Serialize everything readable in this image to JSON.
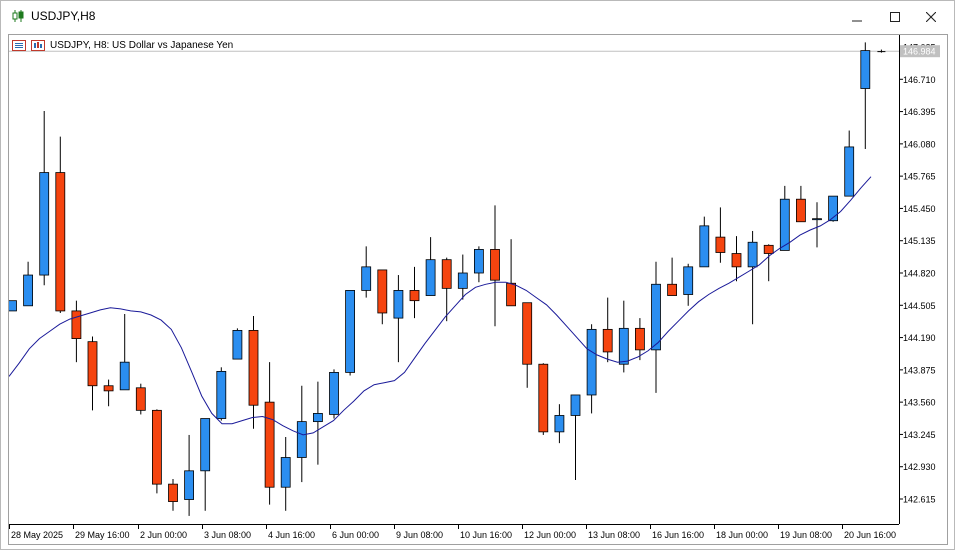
{
  "window": {
    "title": "USDJPY,H8",
    "icons": {
      "app": "candlestick-chart-icon",
      "minimize": "minimize-icon",
      "maximize": "maximize-icon",
      "close": "close-icon"
    }
  },
  "chart_header": {
    "text": "USDJPY, H8:  US Dollar vs Japanese Yen",
    "icons": [
      "ohlc-box-icon",
      "chart-settings-icon"
    ]
  },
  "colors": {
    "bull": "#2b8ef0",
    "bear": "#f5440f",
    "ma": "#1a1a99",
    "axis": "#000000",
    "price_label_bg": "#c0c0c0",
    "price_label_text": "#ffffff"
  },
  "chart_data": {
    "type": "candlestick",
    "symbol": "USDJPY",
    "timeframe": "H8",
    "current_price": "146.984",
    "y_ticks": [
      "147.025",
      "146.710",
      "146.395",
      "146.080",
      "145.765",
      "145.450",
      "145.135",
      "144.820",
      "144.505",
      "144.190",
      "143.875",
      "143.560",
      "143.245",
      "142.930",
      "142.615"
    ],
    "x_labels": [
      "28 May 2025",
      "29 May 16:00",
      "2 Jun 00:00",
      "3 Jun 08:00",
      "4 Jun 16:00",
      "6 Jun 00:00",
      "9 Jun 08:00",
      "10 Jun 16:00",
      "12 Jun 00:00",
      "13 Jun 08:00",
      "16 Jun 16:00",
      "18 Jun 00:00",
      "19 Jun 08:00",
      "20 Jun 16:00"
    ],
    "candles": [
      {
        "o": 144.45,
        "h": 144.55,
        "l": 144.45,
        "c": 144.55
      },
      {
        "o": 144.5,
        "h": 144.93,
        "l": 144.5,
        "c": 144.8
      },
      {
        "o": 144.8,
        "h": 146.4,
        "l": 144.7,
        "c": 145.8
      },
      {
        "o": 145.8,
        "h": 146.15,
        "l": 144.43,
        "c": 144.45
      },
      {
        "o": 144.45,
        "h": 144.55,
        "l": 143.95,
        "c": 144.18
      },
      {
        "o": 144.15,
        "h": 144.2,
        "l": 143.48,
        "c": 143.72
      },
      {
        "o": 143.72,
        "h": 143.78,
        "l": 143.52,
        "c": 143.67
      },
      {
        "o": 143.68,
        "h": 144.42,
        "l": 143.68,
        "c": 143.95
      },
      {
        "o": 143.7,
        "h": 143.74,
        "l": 143.44,
        "c": 143.48
      },
      {
        "o": 143.48,
        "h": 143.49,
        "l": 142.67,
        "c": 142.76
      },
      {
        "o": 142.76,
        "h": 142.81,
        "l": 142.5,
        "c": 142.59
      },
      {
        "o": 142.61,
        "h": 143.24,
        "l": 142.45,
        "c": 142.89
      },
      {
        "o": 142.89,
        "h": 143.36,
        "l": 142.5,
        "c": 143.4
      },
      {
        "o": 143.4,
        "h": 143.9,
        "l": 143.38,
        "c": 143.86
      },
      {
        "o": 143.98,
        "h": 144.28,
        "l": 143.98,
        "c": 144.26
      },
      {
        "o": 144.26,
        "h": 144.4,
        "l": 143.3,
        "c": 143.53
      },
      {
        "o": 143.56,
        "h": 143.95,
        "l": 142.56,
        "c": 142.73
      },
      {
        "o": 142.73,
        "h": 143.22,
        "l": 142.5,
        "c": 143.02
      },
      {
        "o": 143.02,
        "h": 143.72,
        "l": 142.78,
        "c": 143.37
      },
      {
        "o": 143.37,
        "h": 143.76,
        "l": 142.95,
        "c": 143.45
      },
      {
        "o": 143.44,
        "h": 143.88,
        "l": 143.4,
        "c": 143.85
      },
      {
        "o": 143.85,
        "h": 144.65,
        "l": 143.82,
        "c": 144.65
      },
      {
        "o": 144.65,
        "h": 145.08,
        "l": 144.58,
        "c": 144.88
      },
      {
        "o": 144.85,
        "h": 144.85,
        "l": 144.32,
        "c": 144.43
      },
      {
        "o": 144.38,
        "h": 144.8,
        "l": 143.95,
        "c": 144.65
      },
      {
        "o": 144.65,
        "h": 144.88,
        "l": 144.38,
        "c": 144.55
      },
      {
        "o": 144.6,
        "h": 145.17,
        "l": 144.6,
        "c": 144.95
      },
      {
        "o": 144.95,
        "h": 144.97,
        "l": 144.35,
        "c": 144.67
      },
      {
        "o": 144.67,
        "h": 145.0,
        "l": 144.56,
        "c": 144.82
      },
      {
        "o": 144.82,
        "h": 145.08,
        "l": 144.73,
        "c": 145.05
      },
      {
        "o": 145.05,
        "h": 145.48,
        "l": 144.3,
        "c": 144.75
      },
      {
        "o": 144.72,
        "h": 145.15,
        "l": 144.5,
        "c": 144.5
      },
      {
        "o": 144.53,
        "h": 144.53,
        "l": 143.7,
        "c": 143.93
      },
      {
        "o": 143.93,
        "h": 143.94,
        "l": 143.24,
        "c": 143.27
      },
      {
        "o": 143.27,
        "h": 143.54,
        "l": 143.16,
        "c": 143.43
      },
      {
        "o": 143.43,
        "h": 143.62,
        "l": 142.8,
        "c": 143.63
      },
      {
        "o": 143.63,
        "h": 144.32,
        "l": 143.45,
        "c": 144.27
      },
      {
        "o": 144.27,
        "h": 144.58,
        "l": 143.95,
        "c": 144.05
      },
      {
        "o": 143.93,
        "h": 144.55,
        "l": 143.85,
        "c": 144.28
      },
      {
        "o": 144.28,
        "h": 144.38,
        "l": 143.97,
        "c": 144.07
      },
      {
        "o": 144.07,
        "h": 144.93,
        "l": 143.65,
        "c": 144.71
      },
      {
        "o": 144.71,
        "h": 144.97,
        "l": 144.6,
        "c": 144.6
      },
      {
        "o": 144.61,
        "h": 144.91,
        "l": 144.5,
        "c": 144.88
      },
      {
        "o": 144.88,
        "h": 145.37,
        "l": 144.88,
        "c": 145.28
      },
      {
        "o": 145.17,
        "h": 145.46,
        "l": 144.92,
        "c": 145.02
      },
      {
        "o": 145.01,
        "h": 145.18,
        "l": 144.74,
        "c": 144.88
      },
      {
        "o": 144.88,
        "h": 145.23,
        "l": 144.32,
        "c": 145.12
      },
      {
        "o": 145.09,
        "h": 145.1,
        "l": 144.74,
        "c": 145.01
      },
      {
        "o": 145.04,
        "h": 145.67,
        "l": 145.04,
        "c": 145.54
      },
      {
        "o": 145.54,
        "h": 145.67,
        "l": 145.32,
        "c": 145.32
      },
      {
        "o": 145.34,
        "h": 145.51,
        "l": 145.07,
        "c": 145.35
      },
      {
        "o": 145.33,
        "h": 145.56,
        "l": 145.32,
        "c": 145.57
      },
      {
        "o": 145.57,
        "h": 146.21,
        "l": 145.57,
        "c": 146.05
      },
      {
        "o": 146.62,
        "h": 147.07,
        "l": 146.03,
        "c": 146.99
      },
      {
        "o": 146.98,
        "h": 147.0,
        "l": 146.97,
        "c": 146.98
      }
    ],
    "moving_average": [
      143.81,
      143.94,
      144.08,
      144.18,
      144.25,
      144.32,
      144.37,
      144.4,
      144.43,
      144.46,
      144.48,
      144.47,
      144.45,
      144.44,
      144.41,
      144.36,
      144.27,
      144.09,
      143.86,
      143.62,
      143.45,
      143.35,
      143.35,
      143.38,
      143.41,
      143.42,
      143.39,
      143.33,
      143.28,
      143.24,
      143.26,
      143.32,
      143.38,
      143.48,
      143.57,
      143.67,
      143.73,
      143.75,
      143.77,
      143.85,
      143.99,
      144.13,
      144.26,
      144.39,
      144.5,
      144.61,
      144.68,
      144.71,
      144.73,
      144.73,
      144.7,
      144.65,
      144.58,
      144.51,
      144.41,
      144.3,
      144.19,
      144.08,
      144.02,
      143.98,
      143.95,
      143.96,
      144.0,
      144.06,
      144.14,
      144.25,
      144.35,
      144.45,
      144.54,
      144.61,
      144.67,
      144.72,
      144.78,
      144.84,
      144.9,
      144.99,
      145.06,
      145.12,
      145.19,
      145.24,
      145.28,
      145.34,
      145.42,
      145.53,
      145.65,
      145.76
    ]
  }
}
